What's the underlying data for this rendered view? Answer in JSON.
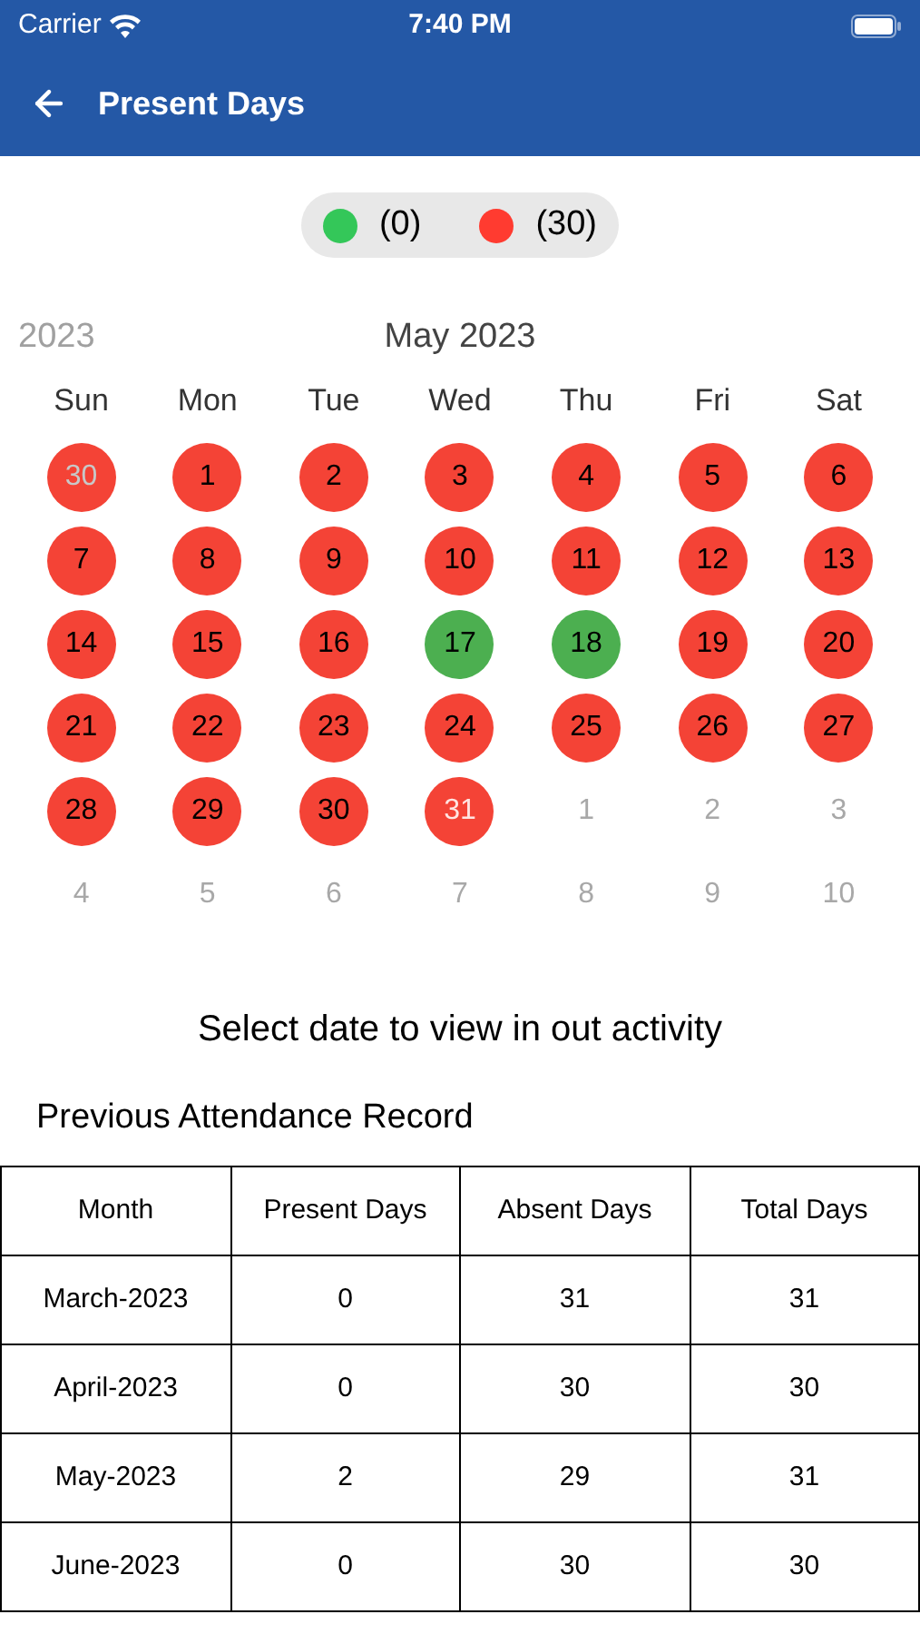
{
  "status_bar": {
    "carrier": "Carrier",
    "time": "7:40 PM"
  },
  "nav": {
    "title": "Present Days"
  },
  "legend": [
    {
      "color": "#34c759",
      "count": "(0)"
    },
    {
      "color": "#ff3b30",
      "count": "(30)"
    }
  ],
  "calendar": {
    "previous_label": "2023",
    "month_title": "May 2023",
    "weekdays": [
      "Sun",
      "Mon",
      "Tue",
      "Wed",
      "Thu",
      "Fri",
      "Sat"
    ],
    "days": [
      {
        "day": "30",
        "kind": "absent",
        "outside": true
      },
      {
        "day": "1",
        "kind": "absent",
        "outside": false
      },
      {
        "day": "2",
        "kind": "absent",
        "outside": false
      },
      {
        "day": "3",
        "kind": "absent",
        "outside": false
      },
      {
        "day": "4",
        "kind": "absent",
        "outside": false
      },
      {
        "day": "5",
        "kind": "absent",
        "outside": false
      },
      {
        "day": "6",
        "kind": "absent",
        "outside": false
      },
      {
        "day": "7",
        "kind": "absent",
        "outside": false
      },
      {
        "day": "8",
        "kind": "absent",
        "outside": false
      },
      {
        "day": "9",
        "kind": "absent",
        "outside": false
      },
      {
        "day": "10",
        "kind": "absent",
        "outside": false
      },
      {
        "day": "11",
        "kind": "absent",
        "outside": false
      },
      {
        "day": "12",
        "kind": "absent",
        "outside": false
      },
      {
        "day": "13",
        "kind": "absent",
        "outside": false
      },
      {
        "day": "14",
        "kind": "absent",
        "outside": false
      },
      {
        "day": "15",
        "kind": "absent",
        "outside": false
      },
      {
        "day": "16",
        "kind": "absent",
        "outside": false
      },
      {
        "day": "17",
        "kind": "present",
        "outside": false
      },
      {
        "day": "18",
        "kind": "present",
        "outside": false
      },
      {
        "day": "19",
        "kind": "absent",
        "outside": false
      },
      {
        "day": "20",
        "kind": "absent",
        "outside": false
      },
      {
        "day": "21",
        "kind": "absent",
        "outside": false
      },
      {
        "day": "22",
        "kind": "absent",
        "outside": false
      },
      {
        "day": "23",
        "kind": "absent",
        "outside": false
      },
      {
        "day": "24",
        "kind": "absent",
        "outside": false
      },
      {
        "day": "25",
        "kind": "absent",
        "outside": false
      },
      {
        "day": "26",
        "kind": "absent",
        "outside": false
      },
      {
        "day": "27",
        "kind": "absent",
        "outside": false
      },
      {
        "day": "28",
        "kind": "absent",
        "outside": false
      },
      {
        "day": "29",
        "kind": "absent",
        "outside": false
      },
      {
        "day": "30",
        "kind": "absent",
        "outside": false
      },
      {
        "day": "31",
        "kind": "today",
        "outside": false
      },
      {
        "day": "1",
        "kind": "plain",
        "outside": true
      },
      {
        "day": "2",
        "kind": "plain",
        "outside": true
      },
      {
        "day": "3",
        "kind": "plain",
        "outside": true
      },
      {
        "day": "4",
        "kind": "plain",
        "outside": true
      },
      {
        "day": "5",
        "kind": "plain",
        "outside": true
      },
      {
        "day": "6",
        "kind": "plain",
        "outside": true
      },
      {
        "day": "7",
        "kind": "plain",
        "outside": true
      },
      {
        "day": "8",
        "kind": "plain",
        "outside": true
      },
      {
        "day": "9",
        "kind": "plain",
        "outside": true
      },
      {
        "day": "10",
        "kind": "plain",
        "outside": true
      }
    ]
  },
  "hint": "Select date to view in out activity",
  "record": {
    "title": "Previous Attendance Record",
    "columns": [
      "Month",
      "Present Days",
      "Absent Days",
      "Total Days"
    ],
    "rows": [
      [
        "March-2023",
        "0",
        "31",
        "31"
      ],
      [
        "April-2023",
        "0",
        "30",
        "30"
      ],
      [
        "May-2023",
        "2",
        "29",
        "31"
      ],
      [
        "June-2023",
        "0",
        "30",
        "30"
      ]
    ]
  }
}
